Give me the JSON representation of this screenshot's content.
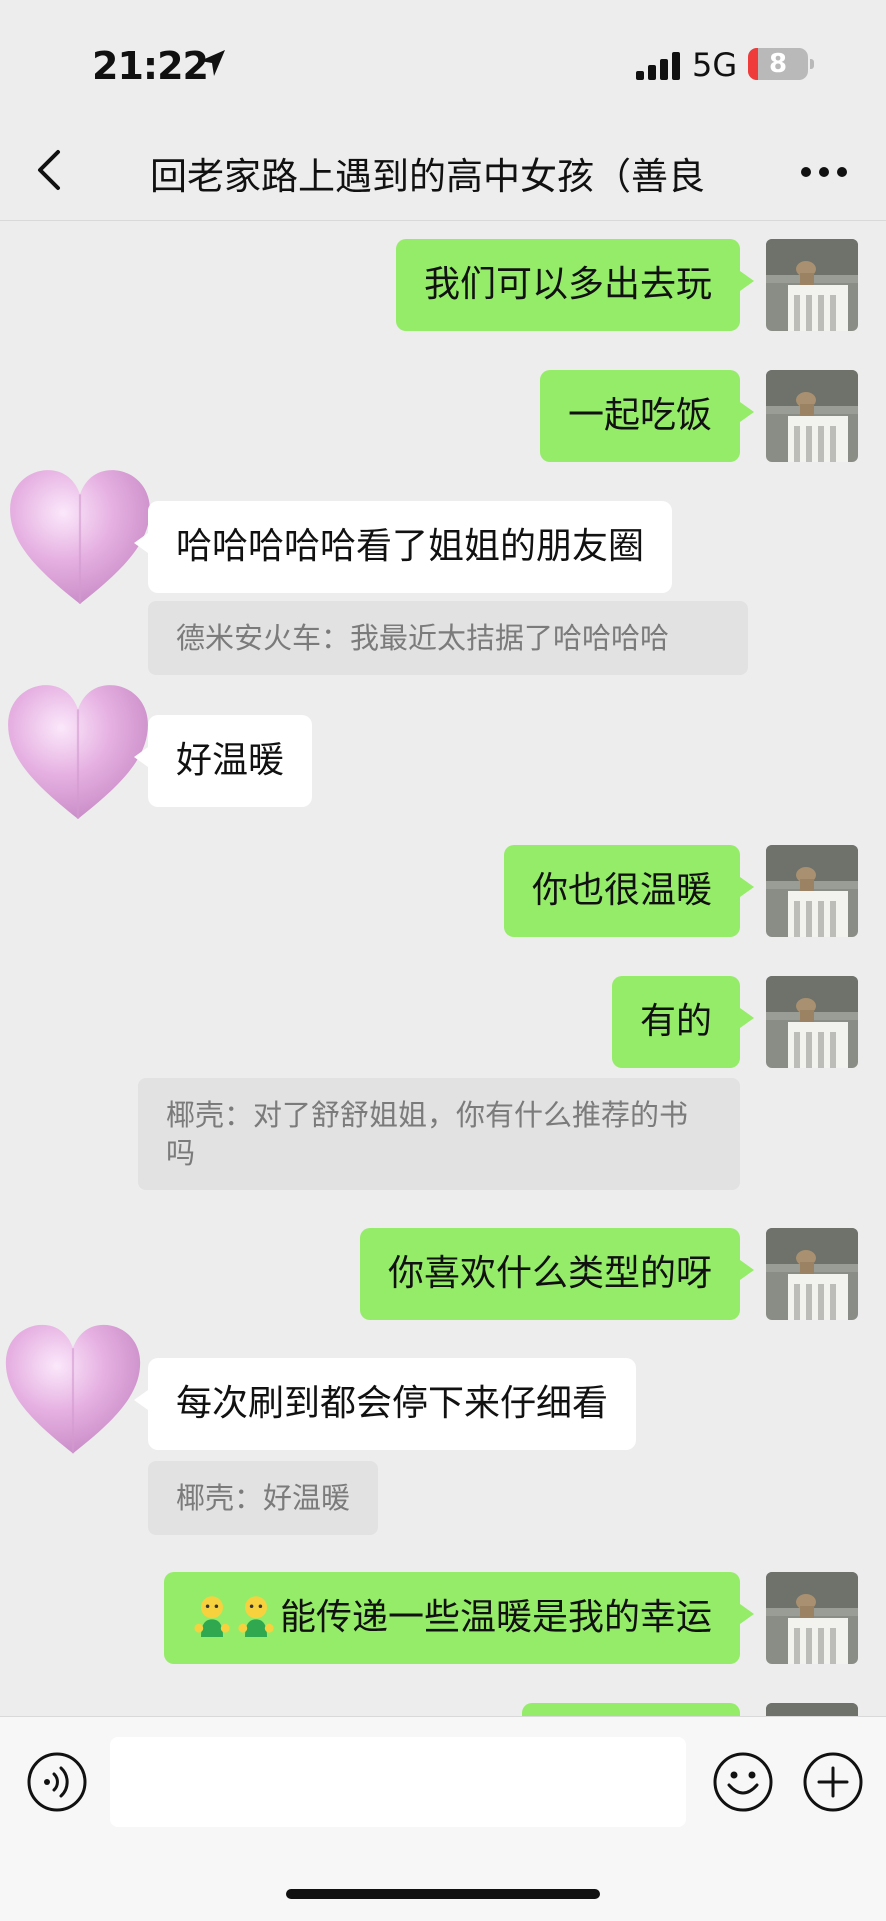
{
  "status_bar": {
    "time": "21:22",
    "network": "5G",
    "battery": "8"
  },
  "nav": {
    "title": "回老家路上遇到的高中女孩（善良"
  },
  "messages": [
    {
      "text": "我们可以多出去玩"
    },
    {
      "text": "一起吃饭"
    },
    {
      "text": "哈哈哈哈哈看了姐姐的朋友圈",
      "quote": "德米安火车：我最近太拮据了哈哈哈哈"
    },
    {
      "text": "好温暖"
    },
    {
      "text": "你也很温暖"
    },
    {
      "text": "有的",
      "quote": "椰壳：对了舒舒姐姐，你有什么推荐的书吗"
    },
    {
      "text": "你喜欢什么类型的呀"
    },
    {
      "text": "每次刷到都会停下来仔细看",
      "quote": "椰壳：好温暖"
    },
    {
      "text": "能传递一些温暖是我的幸运"
    }
  ],
  "colors": {
    "my_bubble": "#95ec69",
    "other_bubble": "#ffffff",
    "background": "#ededed",
    "heart": "#e6b1e2"
  },
  "icons": [
    "location-arrow-icon",
    "signal-icon",
    "back-icon",
    "more-icon",
    "voice-icon",
    "emoji-icon",
    "plus-icon",
    "heart-avatar-icon",
    "person-emoji-icon"
  ]
}
